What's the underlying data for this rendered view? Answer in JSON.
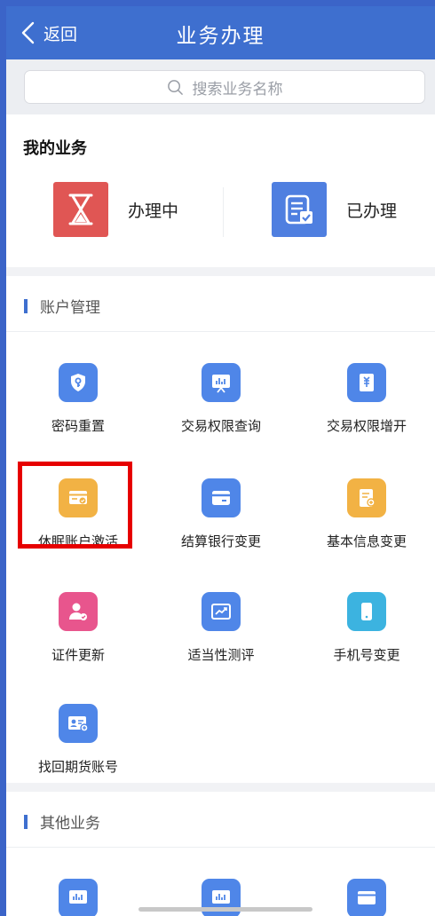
{
  "header": {
    "back_label": "返回",
    "title": "业务办理"
  },
  "search": {
    "placeholder": "搜索业务名称"
  },
  "my_business": {
    "title": "我的业务",
    "in_progress": "办理中",
    "done": "已办理"
  },
  "account_section": {
    "title": "账户管理",
    "items": [
      {
        "label": "密码重置",
        "icon": "shield-key-icon",
        "color": "#4f86e8"
      },
      {
        "label": "交易权限查询",
        "icon": "chart-board-icon",
        "color": "#4f86e8"
      },
      {
        "label": "交易权限增开",
        "icon": "yuan-document-icon",
        "color": "#4f86e8"
      },
      {
        "label": "休眠账户激活",
        "icon": "card-check-icon",
        "color": "#f2b244"
      },
      {
        "label": "结算银行变更",
        "icon": "bank-card-icon",
        "color": "#4f86e8"
      },
      {
        "label": "基本信息变更",
        "icon": "document-plus-icon",
        "color": "#f2b244"
      },
      {
        "label": "证件更新",
        "icon": "user-check-icon",
        "color": "#e8558d"
      },
      {
        "label": "适当性测评",
        "icon": "line-chart-icon",
        "color": "#4f86e8"
      },
      {
        "label": "手机号变更",
        "icon": "mobile-icon",
        "color": "#3cb3e0"
      },
      {
        "label": "找回期货账号",
        "icon": "id-card-icon",
        "color": "#4f86e8"
      }
    ]
  },
  "other_section": {
    "title": "其他业务",
    "items": [
      {
        "icon": "chart-board-icon",
        "color": "#4f86e8"
      },
      {
        "icon": "chart-board-icon",
        "color": "#4f86e8"
      },
      {
        "icon": "card-icon",
        "color": "#4f86e8"
      }
    ]
  },
  "colors": {
    "header": "#3e6fcf",
    "highlight": "#e60000",
    "in_progress_tile": "#e05654",
    "done_tile": "#4f7fe0"
  }
}
